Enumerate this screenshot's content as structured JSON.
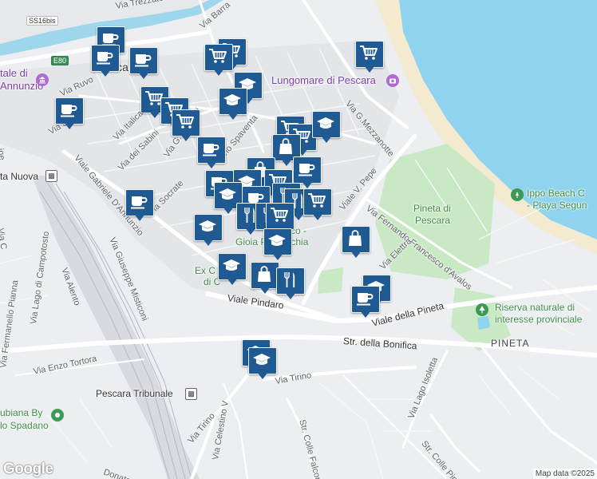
{
  "map": {
    "attribution": "Map data ©2025",
    "logo": "Google",
    "colors": {
      "sea": "#8fd3ee",
      "beach": "#f3ead0",
      "park": "#c9e9c4",
      "road": "#ffffff",
      "rail": "#c4c7cc",
      "marker": "#1f5a93",
      "poi": "#7b3fa6"
    }
  },
  "labels": {
    "ss16bis": "SS16bis",
    "e80": "E80",
    "via_trezzato": "Via Trezzato",
    "via_barra": "Via Barra",
    "via_ruvo": "Via Ruvo",
    "via_ga": "Via G.",
    "via_italica": "Via Italica",
    "via_sabini": "Via dei Sabini",
    "via_marconi": "Via G. Marconi",
    "via_spaventa": "Silvio Spaventa",
    "via_socrate": "Via Socrate",
    "via_mezzanotte": "Via G.Mezzanotte",
    "viale_pepe": "Viale V. Pepe",
    "viale_gd": "Viale Gabriele D'Annunzio",
    "via_misticoni": "Via Giuseppe Misticoni",
    "via_fd": "Via Fernando Francesco d'Avalos",
    "via_elettra": "Via Elettra",
    "viale_pineta": "Viale della Pineta",
    "viale_pindaro": "Viale Pindaro",
    "str_bonifica": "Str. della Bonifica",
    "via_tirino": "Via Tirino",
    "via_tirino2": "Via Tirino",
    "via_lago_isoletta": "Via Lago Isoletta",
    "str_colle_pineta": "Str. Colle Pineta",
    "str_colle_falcone": "Str. Colle Falcone",
    "via_celestino": "Via Celestino V",
    "via_enzo": "Via Enzo Tortora",
    "via_alento": "Via Alento",
    "via_lago_camp": "Via Lago di Campotosto",
    "via_fermanel": "Via Fermanello Pianna",
    "via_donato": "Donato",
    "via_line": "ine",
    "via_c": "Via C",
    "pescara": "Pesca",
    "porta_nuova": "ta Nuova",
    "pescara_tribunale": "Pescara Tribunale",
    "lungomare": "Lungomare di Pescara",
    "ippo": "Ippo Beach C",
    "ippo2": "- Playa Segun",
    "pineta_park": "Pineta di",
    "pineta_park2": "Pescara",
    "riserva": "Riserva naturale di",
    "riserva2": "interesse provinciale",
    "pineta_district": "PINETA",
    "adriatico": "Adriatico -",
    "gioia": "Gioia Pernacchia",
    "ex_c": "Ex C",
    "di_c": "di C",
    "dannunzio": "Annunzio",
    "dannunzio_top": "tale di",
    "ubiana": "ubiana By",
    "spadano": "lo Spadano"
  }
}
